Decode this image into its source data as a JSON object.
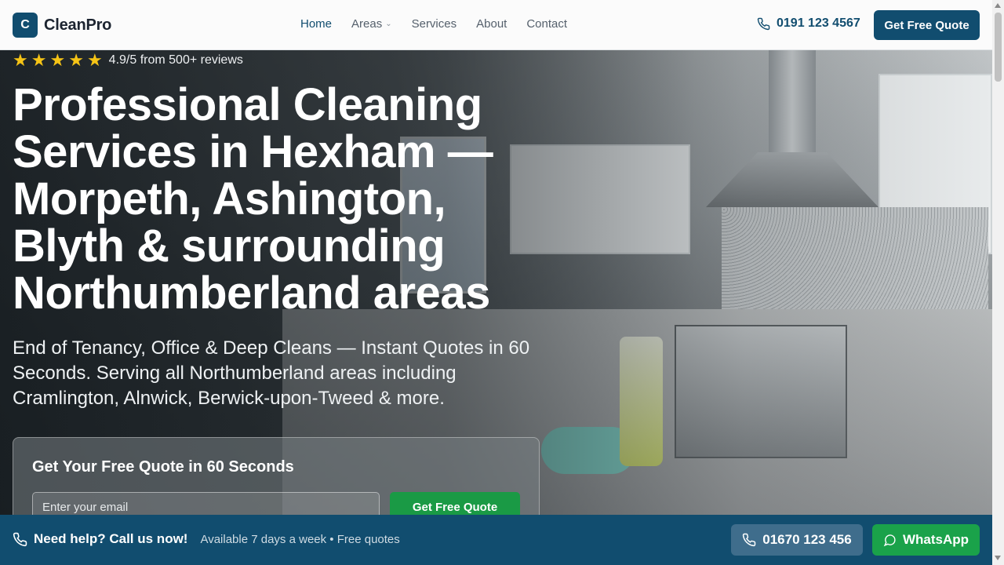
{
  "brand": {
    "logo_letter": "C",
    "name": "CleanPro",
    "color": "#114d6f"
  },
  "nav": {
    "items": [
      {
        "label": "Home",
        "active": true
      },
      {
        "label": "Areas",
        "dropdown": true
      },
      {
        "label": "Services"
      },
      {
        "label": "About"
      },
      {
        "label": "Contact"
      }
    ]
  },
  "header": {
    "phone": "0191 123 4567",
    "cta": "Get Free Quote"
  },
  "hero": {
    "stars": [
      "★",
      "★",
      "★",
      "★",
      "★"
    ],
    "rating_text": "4.9/5 from 500+ reviews",
    "title": "Professional Cleaning Services in Hexham — Morpeth, Ashington, Blyth & surrounding Northumberland areas",
    "subtitle": "End of Tenancy, Office & Deep Cleans — Instant Quotes in 60 Seconds. Serving all Northumberland areas including Cramlington, Alnwick, Berwick-upon-Tweed & more."
  },
  "quote_form": {
    "title": "Get Your Free Quote in 60 Seconds",
    "email_placeholder": "Enter your email",
    "button": "Get Free Quote"
  },
  "bottom_bar": {
    "help_title": "Need help? Call us now!",
    "help_note": "Available 7 days a week • Free quotes",
    "phone": "01670 123 456",
    "whatsapp": "WhatsApp"
  },
  "colors": {
    "accent": "#114d6f",
    "green": "#1aa24a",
    "star": "#f6c416"
  }
}
